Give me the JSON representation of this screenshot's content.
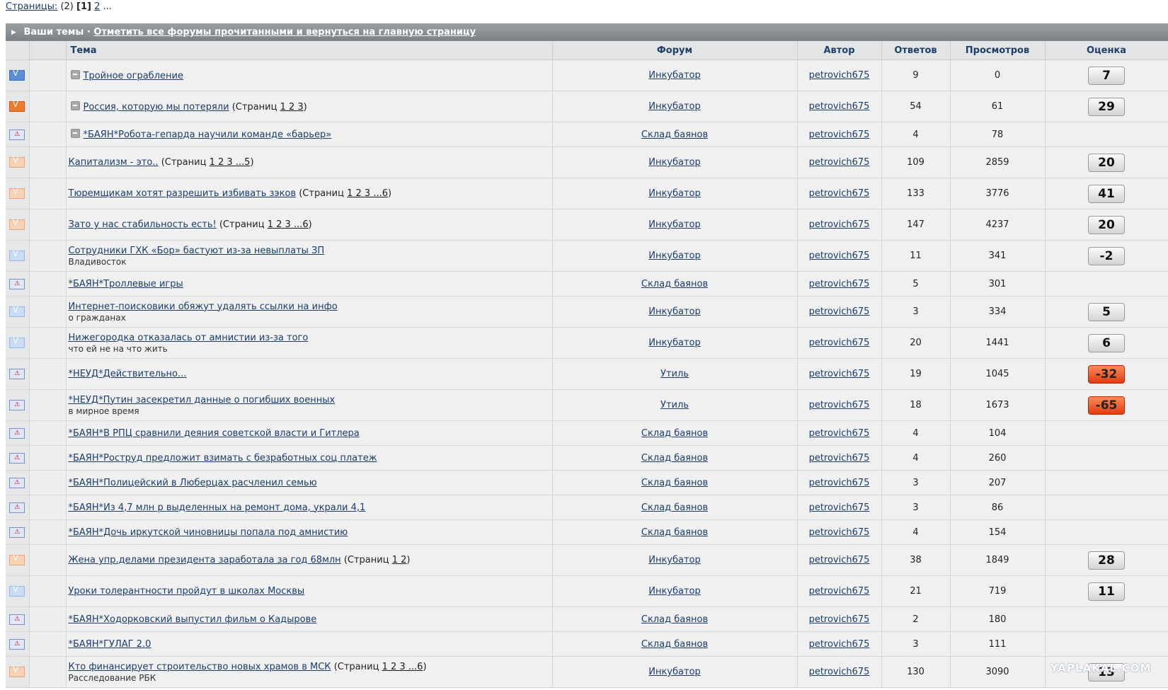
{
  "pager": {
    "label": "Страницы:",
    "total": "(2)",
    "current": "[1]",
    "next": "2",
    "more": "..."
  },
  "titlebar": {
    "title": "Ваши темы",
    "separator": "·",
    "mark_read": "Отметить все форумы прочитанными и вернуться на главную страницу"
  },
  "columns": {
    "topic": "Тема",
    "forum": "Форум",
    "author": "Автор",
    "replies": "Ответов",
    "views": "Просмотров",
    "rating": "Оценка"
  },
  "pages_prefix": "(Страниц",
  "pages_suffix": ")",
  "rows": [
    {
      "icon": "mail-blue-icon",
      "lock": true,
      "title": "Тройное ограбление",
      "pages": "",
      "sub": "",
      "forum": "Инкубатор",
      "author": "petrovich675",
      "replies": "9",
      "views": "0",
      "score": "7",
      "neg": false
    },
    {
      "icon": "mail-orange-icon",
      "lock": true,
      "title": "Россия, которую мы потеряли",
      "pages": "1 2 3",
      "sub": "",
      "forum": "Инкубатор",
      "author": "petrovich675",
      "replies": "54",
      "views": "61",
      "score": "29",
      "neg": false
    },
    {
      "icon": "hot-topic-icon",
      "lock": true,
      "title": "*БАЯН*Робота-гепарда научили команде «барьер»",
      "pages": "",
      "sub": "",
      "forum": "Склад баянов",
      "author": "petrovich675",
      "replies": "4",
      "views": "78",
      "score": "",
      "neg": false
    },
    {
      "icon": "mail-lightorange-icon",
      "lock": false,
      "title": "Капитализм - это..",
      "pages": "1 2 3 ...5",
      "sub": "",
      "forum": "Инкубатор",
      "author": "petrovich675",
      "replies": "109",
      "views": "2859",
      "score": "20",
      "neg": false
    },
    {
      "icon": "mail-lightorange-icon",
      "lock": false,
      "title": "Тюремщикам хотят разрешить избивать зэков",
      "pages": "1 2 3 ...6",
      "sub": "",
      "forum": "Инкубатор",
      "author": "petrovich675",
      "replies": "133",
      "views": "3776",
      "score": "41",
      "neg": false
    },
    {
      "icon": "mail-lightorange-icon",
      "lock": false,
      "title": "Зато у нас стабильность есть!",
      "pages": "1 2 3 ...6",
      "sub": "",
      "forum": "Инкубатор",
      "author": "petrovich675",
      "replies": "147",
      "views": "4237",
      "score": "20",
      "neg": false
    },
    {
      "icon": "mail-lightblue-icon",
      "lock": false,
      "title": "Сотрудники ГХК «Бор» бастуют из-за невыплаты ЗП",
      "pages": "",
      "sub": "Владивосток",
      "forum": "Инкубатор",
      "author": "petrovich675",
      "replies": "11",
      "views": "341",
      "score": "-2",
      "neg": false
    },
    {
      "icon": "hot-topic-icon",
      "lock": false,
      "title": "*БАЯН*Троллевые игры",
      "pages": "",
      "sub": "",
      "forum": "Склад баянов",
      "author": "petrovich675",
      "replies": "5",
      "views": "301",
      "score": "",
      "neg": false
    },
    {
      "icon": "mail-lightblue-icon",
      "lock": false,
      "title": "Интернет-поисковики обяжут удалять ссылки на инфо",
      "pages": "",
      "sub": "о гражданах",
      "forum": "Инкубатор",
      "author": "petrovich675",
      "replies": "3",
      "views": "334",
      "score": "5",
      "neg": false
    },
    {
      "icon": "mail-lightblue-icon",
      "lock": false,
      "title": "Нижегородка отказалась от амнистии из-за того",
      "pages": "",
      "sub": "что ей не на что жить",
      "forum": "Инкубатор",
      "author": "petrovich675",
      "replies": "20",
      "views": "1441",
      "score": "6",
      "neg": false
    },
    {
      "icon": "hot-topic-icon",
      "lock": false,
      "title": "*НЕУД*Действительно...",
      "pages": "",
      "sub": "",
      "forum": "Утиль",
      "author": "petrovich675",
      "replies": "19",
      "views": "1045",
      "score": "-32",
      "neg": true
    },
    {
      "icon": "hot-topic-icon",
      "lock": false,
      "title": "*НЕУД*Путин засекретил данные о погибших военных",
      "pages": "",
      "sub": "в мирное время",
      "forum": "Утиль",
      "author": "petrovich675",
      "replies": "18",
      "views": "1673",
      "score": "-65",
      "neg": true
    },
    {
      "icon": "hot-topic-icon",
      "lock": false,
      "title": "*БАЯН*В РПЦ сравнили деяния советской власти и Гитлера",
      "pages": "",
      "sub": "",
      "forum": "Склад баянов",
      "author": "petrovich675",
      "replies": "4",
      "views": "104",
      "score": "",
      "neg": false
    },
    {
      "icon": "hot-topic-icon",
      "lock": false,
      "title": "*БАЯН*Роструд предложит взимать с безработных соц платеж",
      "pages": "",
      "sub": "",
      "forum": "Склад баянов",
      "author": "petrovich675",
      "replies": "4",
      "views": "260",
      "score": "",
      "neg": false
    },
    {
      "icon": "hot-topic-icon",
      "lock": false,
      "title": "*БАЯН*Полицейский в Люберцах расчленил семью",
      "pages": "",
      "sub": "",
      "forum": "Склад баянов",
      "author": "petrovich675",
      "replies": "3",
      "views": "207",
      "score": "",
      "neg": false
    },
    {
      "icon": "hot-topic-icon",
      "lock": false,
      "title": "*БАЯН*Из 4,7 млн р выделенных на ремонт дома, украли 4,1",
      "pages": "",
      "sub": "",
      "forum": "Склад баянов",
      "author": "petrovich675",
      "replies": "3",
      "views": "86",
      "score": "",
      "neg": false
    },
    {
      "icon": "hot-topic-icon",
      "lock": false,
      "title": "*БАЯН*Дочь иркутской чиновницы попала под амнистию",
      "pages": "",
      "sub": "",
      "forum": "Склад баянов",
      "author": "petrovich675",
      "replies": "4",
      "views": "154",
      "score": "",
      "neg": false
    },
    {
      "icon": "mail-lightorange-icon",
      "lock": false,
      "title": "Жена упр.делами президента заработала за год 68млн",
      "pages": "1 2",
      "sub": "",
      "forum": "Инкубатор",
      "author": "petrovich675",
      "replies": "38",
      "views": "1849",
      "score": "28",
      "neg": false
    },
    {
      "icon": "mail-lightblue-icon",
      "lock": false,
      "title": "Уроки толерантности пройдут в школах Москвы",
      "pages": "",
      "sub": "",
      "forum": "Инкубатор",
      "author": "petrovich675",
      "replies": "21",
      "views": "719",
      "score": "11",
      "neg": false
    },
    {
      "icon": "hot-topic-icon",
      "lock": false,
      "title": "*БАЯН*Ходорковский выпустил фильм о Кадырове",
      "pages": "",
      "sub": "",
      "forum": "Склад баянов",
      "author": "petrovich675",
      "replies": "2",
      "views": "180",
      "score": "",
      "neg": false
    },
    {
      "icon": "hot-topic-icon",
      "lock": false,
      "title": "*БАЯН*ГУЛАГ 2.0",
      "pages": "",
      "sub": "",
      "forum": "Склад баянов",
      "author": "petrovich675",
      "replies": "3",
      "views": "111",
      "score": "",
      "neg": false
    },
    {
      "icon": "mail-lightorange-icon",
      "lock": false,
      "title": "Кто финансирует строительство новых храмов в МСК",
      "pages": "1 2 3 ...6",
      "sub": "Расследование РБК",
      "forum": "Инкубатор",
      "author": "petrovich675",
      "replies": "130",
      "views": "3090",
      "score": "13",
      "neg": false
    }
  ],
  "watermark": "YAPLAKAL.COM",
  "colors": {
    "link": "#1b3d6e",
    "header_bg": "#e2e4e6",
    "row_bg": "#f0f0f0",
    "score_negative": "#e23b10"
  }
}
